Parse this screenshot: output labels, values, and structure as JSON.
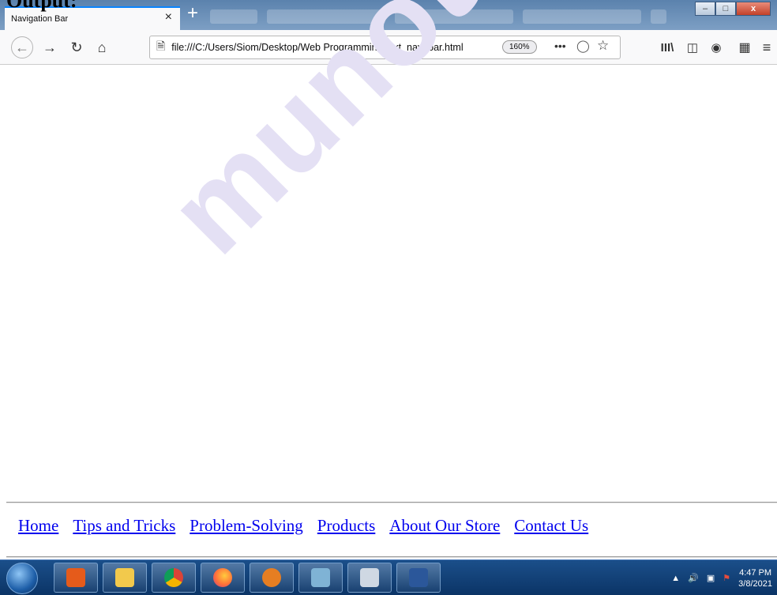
{
  "doc_heading": "Output:",
  "browser": {
    "tab_title": "Navigation Bar",
    "tab_close": "×",
    "new_tab": "+",
    "url": "file:///C:/Users/Siom/Desktop/Web Programming/text_nav_bar.html",
    "zoom": "160%",
    "page_actions": "•••",
    "window_controls": {
      "minimize": "–",
      "maximize": "□",
      "close": "x"
    }
  },
  "toolbar_icons": [
    "back-icon",
    "forward-icon",
    "reload-icon",
    "home-icon",
    "page-icon",
    "pocket-icon",
    "bookmark-star-icon",
    "library-icon",
    "sidebar-icon",
    "account-icon",
    "extensions-icon",
    "menu-icon"
  ],
  "page": {
    "watermark": "munotes.in",
    "nav_links": [
      "Home",
      "Tips and Tricks",
      "Problem-Solving",
      "Products",
      "About Our Store",
      "Contact Us"
    ]
  },
  "taskbar": {
    "apps": [
      "media-player-icon",
      "file-explorer-icon",
      "chrome-icon",
      "firefox-icon",
      "eclipse-icon",
      "notepad-icon",
      "paint-icon",
      "word-icon"
    ],
    "time": "4:47 PM",
    "date": "3/8/2021"
  },
  "colors": {
    "link": "#0000ee",
    "tab_accent": "#0a84ff",
    "taskbar": "#0b3466"
  }
}
